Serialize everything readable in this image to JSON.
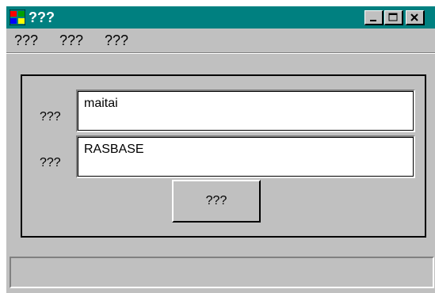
{
  "window": {
    "title": "???",
    "icon": "windows-logo-icon",
    "controls": {
      "minimize": "minimize-icon",
      "maximize": "maximize-icon",
      "close": "close-icon"
    }
  },
  "menu": {
    "items": [
      {
        "label": "???"
      },
      {
        "label": "???"
      },
      {
        "label": "???"
      }
    ]
  },
  "form": {
    "field1": {
      "label": "???",
      "value": "maitai"
    },
    "field2": {
      "label": "???",
      "value": "RASBASE"
    },
    "button": {
      "label": "???"
    }
  },
  "status": {
    "text": ""
  },
  "colors": {
    "titlebar": "#008080",
    "face": "#c0c0c0",
    "text": "#000000"
  }
}
